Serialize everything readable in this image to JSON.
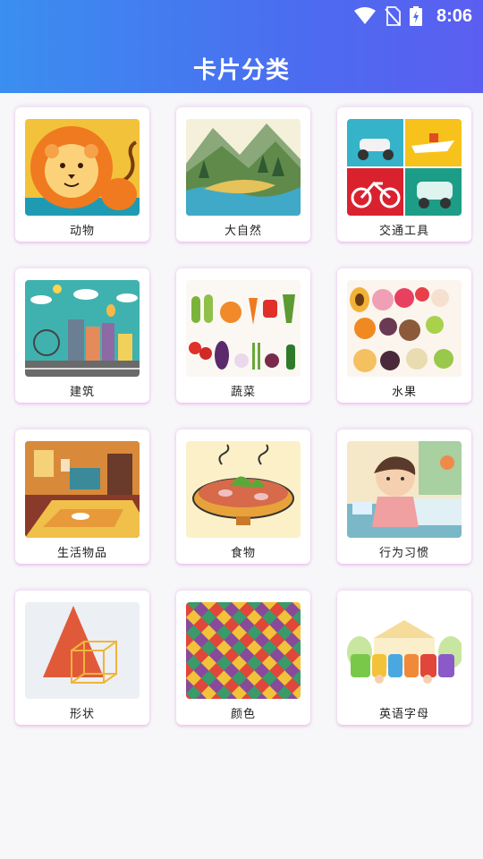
{
  "status": {
    "time": "8:06",
    "icons": [
      "wifi-icon",
      "no-sim-icon",
      "battery-charging-icon"
    ]
  },
  "header": {
    "title": "卡片分类"
  },
  "cards": [
    {
      "label": "动物",
      "icon": "lion-icon"
    },
    {
      "label": "大自然",
      "icon": "nature-icon"
    },
    {
      "label": "交通工具",
      "icon": "vehicles-icon"
    },
    {
      "label": "建筑",
      "icon": "buildings-icon"
    },
    {
      "label": "蔬菜",
      "icon": "vegetables-icon"
    },
    {
      "label": "水果",
      "icon": "fruits-icon"
    },
    {
      "label": "生活物品",
      "icon": "room-icon"
    },
    {
      "label": "食物",
      "icon": "hotpot-icon"
    },
    {
      "label": "行为习惯",
      "icon": "child-washing-icon"
    },
    {
      "label": "形状",
      "icon": "shapes-icon"
    },
    {
      "label": "颜色",
      "icon": "colors-icon"
    },
    {
      "label": "英语字母",
      "icon": "english-icon"
    }
  ]
}
